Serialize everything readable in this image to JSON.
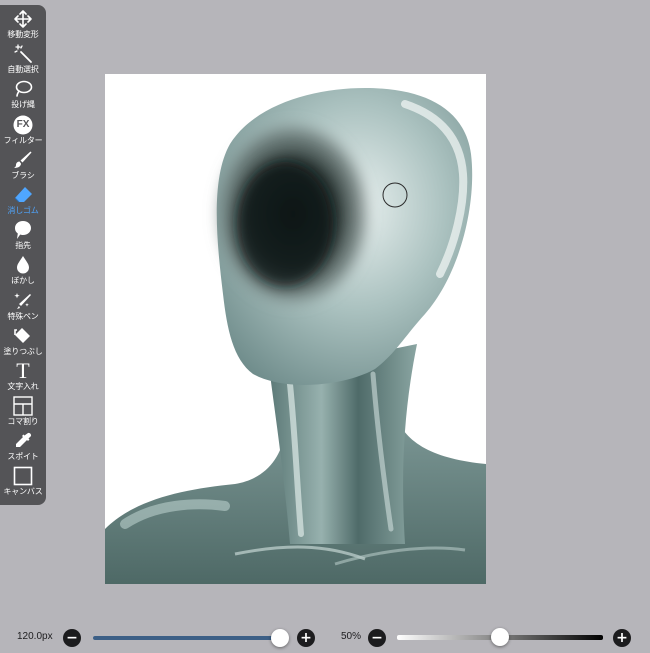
{
  "toolbar": {
    "active_tool": "eraser",
    "active_color": "#4fa6ff",
    "tools": [
      {
        "id": "move",
        "label": "移動変形",
        "icon": "move-arrows-icon"
      },
      {
        "id": "magic-wand",
        "label": "自動選択",
        "icon": "magic-wand-icon"
      },
      {
        "id": "lasso",
        "label": "投げ縄",
        "icon": "lasso-icon"
      },
      {
        "id": "filter",
        "label": "フィルター",
        "icon": "fx-icon",
        "icon_text": "FX"
      },
      {
        "id": "brush",
        "label": "ブラシ",
        "icon": "brush-icon"
      },
      {
        "id": "eraser",
        "label": "消しゴム",
        "icon": "eraser-icon"
      },
      {
        "id": "smudge",
        "label": "指先",
        "icon": "smudge-icon"
      },
      {
        "id": "blur",
        "label": "ぼかし",
        "icon": "blur-drop-icon"
      },
      {
        "id": "special-pen",
        "label": "特殊ペン",
        "icon": "sparkle-pen-icon"
      },
      {
        "id": "fill",
        "label": "塗りつぶし",
        "icon": "fill-bucket-icon"
      },
      {
        "id": "text",
        "label": "文字入れ",
        "icon": "text-icon",
        "icon_text": "T"
      },
      {
        "id": "frame",
        "label": "コマ割り",
        "icon": "frame-divider-icon"
      },
      {
        "id": "eyedropper",
        "label": "スポイト",
        "icon": "eyedropper-icon"
      },
      {
        "id": "canvas",
        "label": "キャンバス",
        "icon": "canvas-icon"
      }
    ]
  },
  "brush_size": {
    "value_label": "120.0px",
    "fraction": 0.96,
    "minus": "−",
    "plus": "+",
    "accent": "#3c5f86"
  },
  "opacity": {
    "value_label": "50%",
    "fraction": 0.5,
    "minus": "−",
    "plus": "+"
  }
}
